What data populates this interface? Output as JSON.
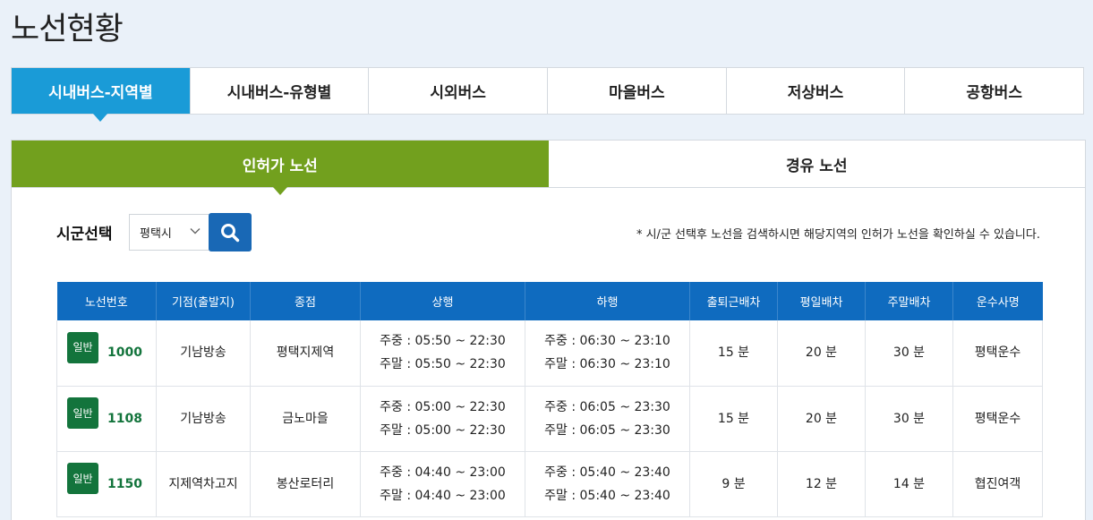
{
  "page": {
    "title": "노선현황"
  },
  "top_tabs": [
    {
      "label": "시내버스-지역별",
      "active": true
    },
    {
      "label": "시내버스-유형별",
      "active": false
    },
    {
      "label": "시외버스",
      "active": false
    },
    {
      "label": "마을버스",
      "active": false
    },
    {
      "label": "저상버스",
      "active": false
    },
    {
      "label": "공항버스",
      "active": false
    }
  ],
  "sub_tabs": [
    {
      "label": "인허가 노선",
      "active": true
    },
    {
      "label": "경유 노선",
      "active": false
    }
  ],
  "filter": {
    "label": "시군선택",
    "selected": "평택시",
    "notice": "* 시/군 선택후 노선을 검색하시면 해당지역의 인허가 노선을 확인하실 수 있습니다."
  },
  "colors": {
    "top_tab_active": "#1a9bd7",
    "sub_tab_active": "#72a01e",
    "table_header": "#0f6bbf",
    "badge": "#13743c",
    "search_button": "#1968b5"
  },
  "icons": {
    "search": "search-icon",
    "dropdown": "chevron-down-icon"
  },
  "table": {
    "headers": [
      "노선번호",
      "기점(출발지)",
      "종점",
      "상행",
      "하행",
      "출퇴근배차",
      "평일배차",
      "주말배차",
      "운수사명"
    ],
    "rows": [
      {
        "badge": "일반",
        "route": "1000",
        "start": "기남방송",
        "end": "평택지제역",
        "up_weekday": "주중 : 05:50 ~ 22:30",
        "up_weekend": "주말 : 05:50 ~ 22:30",
        "down_weekday": "주중 : 06:30 ~ 23:10",
        "down_weekend": "주말 : 06:30 ~ 23:10",
        "rush": "15 분",
        "weekday": "20 분",
        "weekend": "30 분",
        "company": "평택운수"
      },
      {
        "badge": "일반",
        "route": "1108",
        "start": "기남방송",
        "end": "금노마을",
        "up_weekday": "주중 : 05:00 ~ 22:30",
        "up_weekend": "주말 : 05:00 ~ 22:30",
        "down_weekday": "주중 : 06:05 ~ 23:30",
        "down_weekend": "주말 : 06:05 ~ 23:30",
        "rush": "15 분",
        "weekday": "20 분",
        "weekend": "30 분",
        "company": "평택운수"
      },
      {
        "badge": "일반",
        "route": "1150",
        "start": "지제역차고지",
        "end": "봉산로터리",
        "up_weekday": "주중 : 04:40 ~ 23:00",
        "up_weekend": "주말 : 04:40 ~ 23:00",
        "down_weekday": "주중 : 05:40 ~ 23:40",
        "down_weekend": "주말 : 05:40 ~ 23:40",
        "rush": "9 분",
        "weekday": "12 분",
        "weekend": "14 분",
        "company": "협진여객"
      }
    ]
  }
}
